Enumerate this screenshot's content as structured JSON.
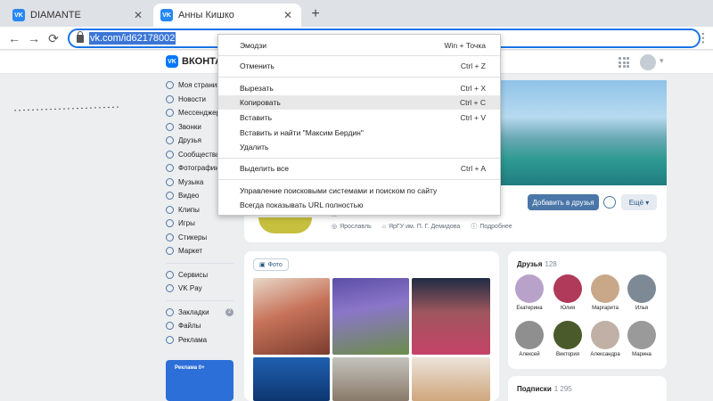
{
  "browser": {
    "tabs": [
      {
        "title": "DIAMANTE",
        "favicon": "VK",
        "close": "✕"
      },
      {
        "title": "Анны Кишко",
        "favicon": "VK",
        "close": "✕"
      }
    ],
    "new_tab": "+",
    "url": "vk.com/id62178002",
    "nav": {
      "back": "←",
      "forward": "→",
      "reload": "⟳",
      "menu": "⋮"
    }
  },
  "vk": {
    "logo_mark": "VK",
    "logo_text": "ВКОНТАКТЕ",
    "nav_items": [
      {
        "label": "Моя страница"
      },
      {
        "label": "Новости"
      },
      {
        "label": "Мессенджер"
      },
      {
        "label": "Звонки"
      },
      {
        "label": "Друзья"
      },
      {
        "label": "Сообщества"
      },
      {
        "label": "Фотографии"
      },
      {
        "label": "Музыка"
      },
      {
        "label": "Видео"
      },
      {
        "label": "Клипы"
      },
      {
        "label": "Игры"
      },
      {
        "label": "Стикеры"
      },
      {
        "label": "Маркет"
      }
    ],
    "nav_items2": [
      {
        "label": "Сервисы"
      },
      {
        "label": "VK Pay"
      }
    ],
    "nav_items3": [
      {
        "label": "Закладки",
        "badge": "2"
      },
      {
        "label": "Файлы"
      },
      {
        "label": "Реклама"
      }
    ],
    "promo_text": "Реклама 0+",
    "profile": {
      "add_friend": "Добавить в друзья",
      "more": "Ещё",
      "truncated_line": "...",
      "city": "Ярославль",
      "university": "ЯрГУ им. П. Г. Демидова",
      "details": "Подробнее"
    },
    "photos": {
      "chip": "Фото"
    },
    "friends": {
      "title": "Друзья",
      "count": "128",
      "list": [
        {
          "name": "Екатерина"
        },
        {
          "name": "Юлия"
        },
        {
          "name": "Маргарита"
        },
        {
          "name": "Илья"
        },
        {
          "name": "Алексей"
        },
        {
          "name": "Виктория"
        },
        {
          "name": "Александра"
        },
        {
          "name": "Марина"
        }
      ]
    },
    "subscribers": {
      "title": "Подписки",
      "count": "1 295"
    }
  },
  "context_menu": {
    "items": [
      {
        "label": "Эмодзи",
        "shortcut": "Win + Точка"
      },
      {
        "label": "Отменить",
        "shortcut": "Ctrl + Z"
      },
      {
        "label": "Вырезать",
        "shortcut": "Ctrl + X"
      },
      {
        "label": "Копировать",
        "shortcut": "Ctrl + C"
      },
      {
        "label": "Вставить",
        "shortcut": "Ctrl + V"
      },
      {
        "label": "Вставить и найти \"Максим Бердин\"",
        "shortcut": ""
      },
      {
        "label": "Удалить",
        "shortcut": ""
      },
      {
        "label": "Выделить все",
        "shortcut": "Ctrl + A"
      },
      {
        "label": "Управление поисковыми системами и поиском по сайту",
        "shortcut": ""
      },
      {
        "label": "Всегда показывать URL полностью",
        "shortcut": ""
      }
    ]
  },
  "colors": {
    "accent": "#1a73e8",
    "vk_blue": "#4a76a8",
    "page_bg": "#edeef0"
  }
}
